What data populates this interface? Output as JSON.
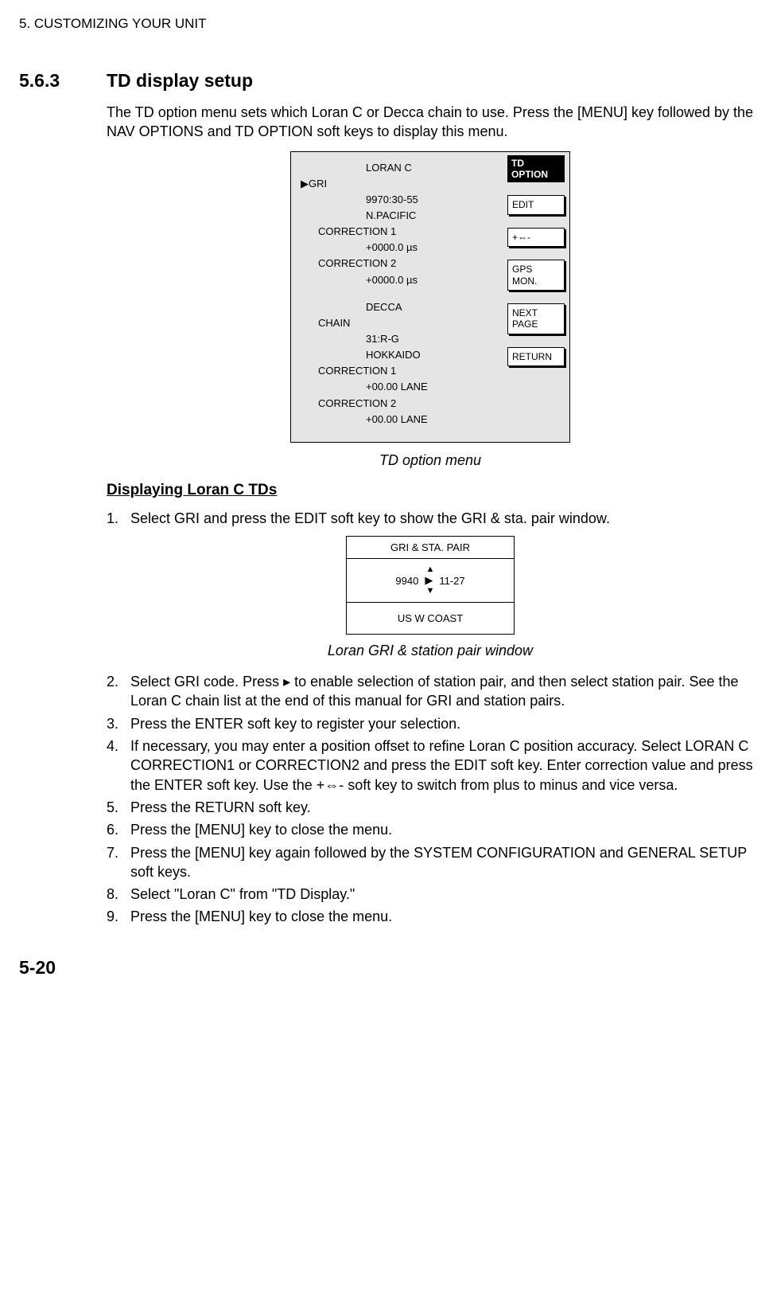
{
  "chapter": "5. CUSTOMIZING YOUR UNIT",
  "section_num": "5.6.3",
  "section_title": "TD display setup",
  "intro": "The TD option menu sets which Loran C or Decca chain to use. Press the [MENU] key followed by the NAV OPTIONS and TD OPTION soft keys to display this menu.",
  "menu": {
    "loran_label": "LORAN C",
    "gri_row": "GRI",
    "gri_value": "9970:30-55",
    "gri_region": "N.PACIFIC",
    "corr1_label": "CORRECTION 1",
    "corr1_value": "+0000.0 µs",
    "corr2_label": "CORRECTION 2",
    "corr2_value": "+0000.0 µs",
    "decca_label": "DECCA",
    "chain_label": "CHAIN",
    "chain_value": "31:R-G",
    "chain_region": "HOKKAIDO",
    "dcorr1_label": "CORRECTION 1",
    "dcorr1_value": "+00.00 LANE",
    "dcorr2_label": "CORRECTION 2",
    "dcorr2_value": "+00.00 LANE"
  },
  "softkeys": {
    "title_l1": "TD",
    "title_l2": "OPTION",
    "edit": "EDIT",
    "plusminus": "+⇔-",
    "gps_l1": "GPS",
    "gps_l2": "MON.",
    "next_l1": "NEXT",
    "next_l2": "PAGE",
    "return": "RETURN"
  },
  "fig1_caption": "TD option menu",
  "subheading": "Displaying Loran C TDs",
  "step1": "Select GRI and press the EDIT soft key to show the GRI & sta. pair window.",
  "gri_window": {
    "title": "GRI & STA. PAIR",
    "left": "9940",
    "right": "11-27",
    "region": "US W COAST"
  },
  "fig2_caption": "Loran GRI & station pair window",
  "step2": "Select GRI code. Press  ▸  to enable selection of station pair, and then select station pair. See the Loran C chain list at the end of this manual for GRI and station pairs.",
  "step3": "Press the ENTER soft key to register your selection.",
  "step4": "If necessary, you may enter a position offset to refine Loran C position accuracy. Select LORAN C CORRECTION1 or CORRECTION2 and press the EDIT soft key. Enter correction value and press the ENTER soft key. Use the +⇔- soft key to switch from plus to minus and vice versa.",
  "step5": "Press the RETURN soft key.",
  "step6": "Press the [MENU] key to close the menu.",
  "step7": "Press the [MENU] key again followed by the SYSTEM CONFIGURATION and GENERAL SETUP soft keys.",
  "step8": "Select \"Loran C\" from \"TD Display.\"",
  "step9": "Press the [MENU] key to close the menu.",
  "page_num": "5-20"
}
